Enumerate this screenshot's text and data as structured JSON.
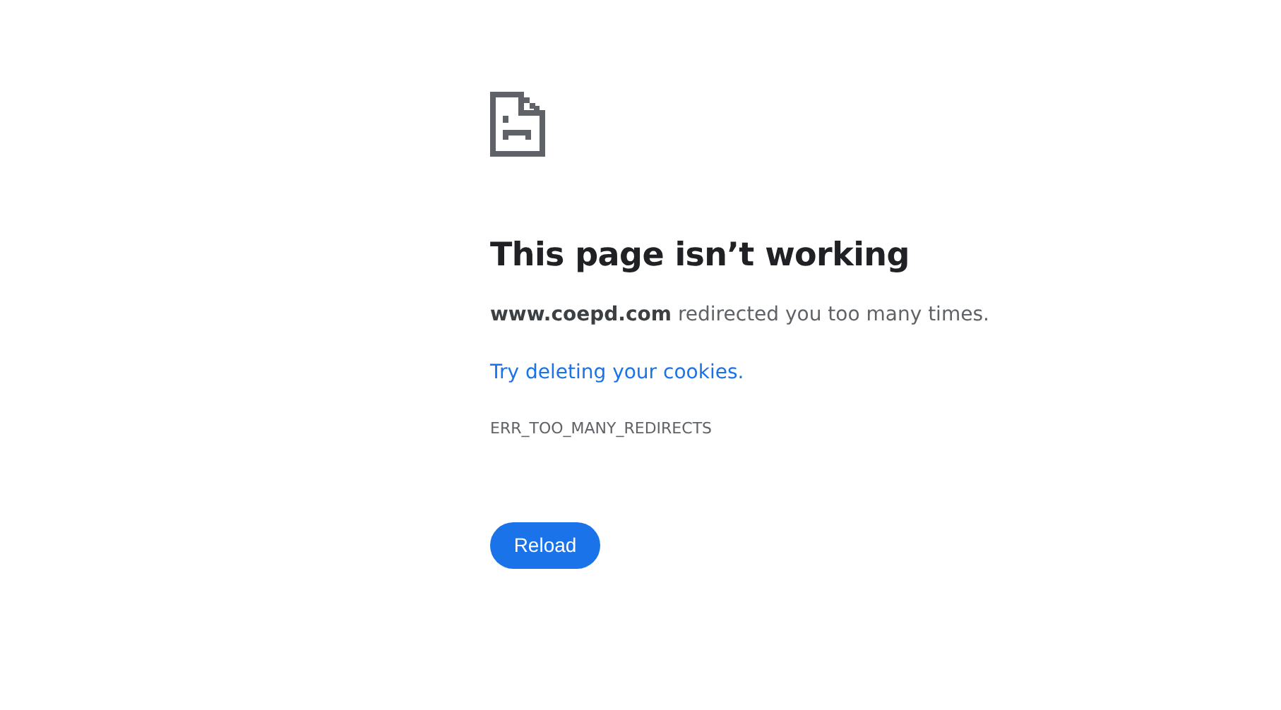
{
  "heading": "This page isn’t working",
  "message": "**www.coepd.com** redirected you too many times.",
  "suggestion_link": "Try deleting your cookies.",
  "error_code": "ERR_TOO_MANY_REDIRECTS",
  "buttons": [
    {
      "label": "Reload",
      "kind": "primary"
    }
  ]
}
